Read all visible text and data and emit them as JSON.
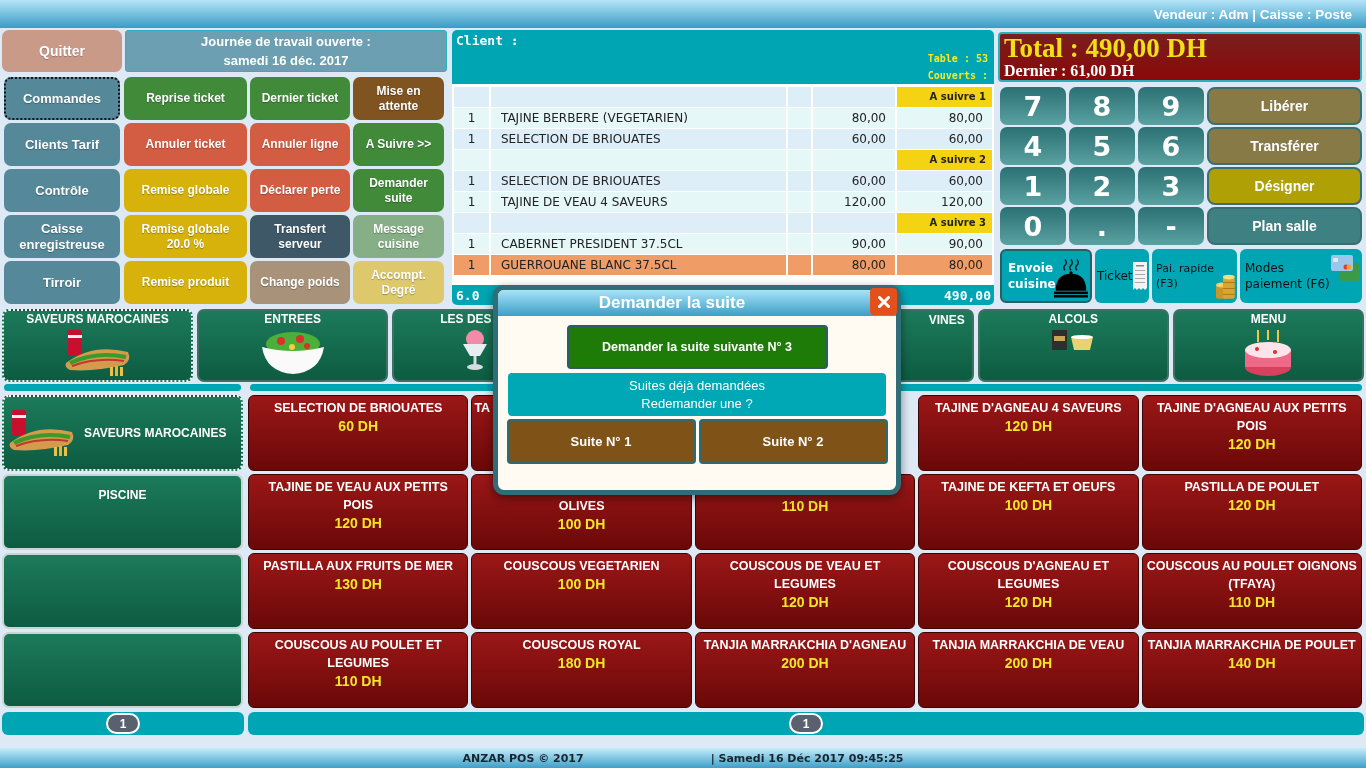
{
  "top_bar": {
    "session": "Vendeur : Adm | Caisse : Poste"
  },
  "quit_button": "Quitter",
  "workday": [
    "Journée de travail ouverte :",
    "samedi 16 déc. 2017"
  ],
  "nav_menu": [
    {
      "label": "Commandes",
      "selected": true
    },
    {
      "label": "Clients Tarif",
      "selected": false
    },
    {
      "label": "Contrôle",
      "selected": false
    },
    {
      "label": "Caisse enregistreuse",
      "selected": false
    },
    {
      "label": "Tirroir",
      "selected": false
    }
  ],
  "actions": [
    {
      "label": "Reprise ticket",
      "color": "#418a3a"
    },
    {
      "label": "Dernier ticket",
      "color": "#418a3a"
    },
    {
      "label": "Mise en attente",
      "color": "#7f5420"
    },
    {
      "label": "Annuler ticket",
      "color": "#d35d43"
    },
    {
      "label": "Annuler ligne",
      "color": "#d35d43"
    },
    {
      "label": "A Suivre >>",
      "color": "#418a3a"
    },
    {
      "label": "Remise globale",
      "color": "#d7b20b"
    },
    {
      "label": "Déclarer perte",
      "color": "#d35d43"
    },
    {
      "label": "Demander suite",
      "color": "#418a3a"
    },
    {
      "label": "Remise globale 20.0 %",
      "color": "#d7b20b"
    },
    {
      "label": "Transfert serveur",
      "color": "#3e5868"
    },
    {
      "label": "Message cuisine",
      "color": "#87af87"
    },
    {
      "label": "Remise produit",
      "color": "#d7b20b"
    },
    {
      "label": "Change poids",
      "color": "#a8937a"
    },
    {
      "label": "Accompt. Degré",
      "color": "#ddc96c"
    }
  ],
  "ticket": {
    "client": "Client :",
    "table": "Table : 53",
    "covers": "Couverts :",
    "courses": [
      {
        "label": "A suivre 1",
        "lines": [
          {
            "qty": "1",
            "name": "TAJINE BERBERE (VEGETARIEN)",
            "price": "80,00",
            "total": "80,00",
            "selected": false
          },
          {
            "qty": "1",
            "name": "SELECTION DE BRIOUATES",
            "price": "60,00",
            "total": "60,00",
            "selected": false
          }
        ]
      },
      {
        "label": "A suivre 2",
        "lines": [
          {
            "qty": "1",
            "name": "SELECTION DE BRIOUATES",
            "price": "60,00",
            "total": "60,00",
            "selected": false
          },
          {
            "qty": "1",
            "name": "TAJINE DE VEAU 4 SAVEURS",
            "price": "120,00",
            "total": "120,00",
            "selected": false
          }
        ]
      },
      {
        "label": "A suivre 3",
        "lines": [
          {
            "qty": "1",
            "name": "CABERNET PRESIDENT 37.5CL",
            "price": "90,00",
            "total": "90,00",
            "selected": false
          },
          {
            "qty": "1",
            "name": "GUERROUANE BLANC 37.5CL",
            "price": "80,00",
            "total": "80,00",
            "selected": true
          }
        ]
      }
    ],
    "line_count": "6.0",
    "total": "490,00"
  },
  "summary": {
    "total": "Total : 490,00 DH",
    "last": "Dernier : 61,00 DH"
  },
  "keypad": {
    "keys": [
      "7",
      "8",
      "9",
      "4",
      "5",
      "6",
      "1",
      "2",
      "3",
      "0",
      ".",
      "-"
    ],
    "actions": [
      {
        "label": "Libérer",
        "color": "#877a46"
      },
      {
        "label": "Transférer",
        "color": "#877a46"
      },
      {
        "label": "Désigner",
        "color": "#afa006"
      },
      {
        "label": "Plan salle",
        "color": "#3f8183"
      }
    ]
  },
  "shortcuts": [
    {
      "label": "Envoie cuisine",
      "kind": "kitchen"
    },
    {
      "label": "Ticket",
      "kind": "receipt"
    },
    {
      "label": "Pai. rapide (F3)",
      "kind": "cash"
    },
    {
      "label": "Modes paiement (F6)",
      "kind": "card"
    }
  ],
  "categories": [
    {
      "label": "SAVEURS MAROCAINES",
      "selected": true,
      "kind": "full"
    },
    {
      "label": "ENTREES",
      "selected": false,
      "kind": "full"
    },
    {
      "label": "LES DES",
      "selected": false,
      "kind": "cut-right"
    },
    {
      "kind": "covered"
    },
    {
      "label": "VINES",
      "selected": false,
      "kind": "cut-left"
    },
    {
      "label": "ALCOLS",
      "selected": false,
      "kind": "full"
    },
    {
      "label": "MENU",
      "selected": false,
      "kind": "full"
    }
  ],
  "subcategories": [
    {
      "label": "SAVEURS MAROCAINES",
      "selected": true,
      "kind": "picture"
    },
    {
      "label": "PISCINE",
      "selected": false,
      "kind": "text"
    },
    {
      "selected": false,
      "kind": "blank"
    },
    {
      "selected": false,
      "kind": "blank"
    }
  ],
  "products": [
    {
      "name": "SELECTION DE BRIOUATES",
      "price": "60 DH",
      "kind": "full"
    },
    {
      "name": "TA",
      "kind": "cut-right"
    },
    {
      "kind": "covered"
    },
    {
      "name": "TAJINE D'AGNEAU 4 SAVEURS",
      "price": "120 DH",
      "kind": "full"
    },
    {
      "name": "TAJINE D'AGNEAU AUX PETITS POIS",
      "price": "120 DH",
      "kind": "full"
    },
    {
      "name": "TAJINE DE VEAU AUX PETITS POIS",
      "price": "120 DH",
      "kind": "full"
    },
    {
      "name": "OLIVES",
      "price": "100 DH",
      "kind": "cut-top"
    },
    {
      "price": "110 DH",
      "kind": "cut-top"
    },
    {
      "name": "TAJINE DE KEFTA ET OEUFS",
      "price": "100 DH",
      "kind": "full"
    },
    {
      "name": "PASTILLA DE POULET",
      "price": "120 DH",
      "kind": "full"
    },
    {
      "name": "PASTILLA AUX FRUITS DE MER",
      "price": "130 DH",
      "kind": "full"
    },
    {
      "name": "COUSCOUS VEGETARIEN",
      "price": "100 DH",
      "kind": "full"
    },
    {
      "name": "COUSCOUS DE VEAU ET LEGUMES",
      "price": "120 DH",
      "kind": "full"
    },
    {
      "name": "COUSCOUS D'AGNEAU ET LEGUMES",
      "price": "120 DH",
      "kind": "full"
    },
    {
      "name": "COUSCOUS AU POULET OIGNONS (TFAYA)",
      "price": "110 DH",
      "kind": "full"
    },
    {
      "name": "COUSCOUS AU POULET ET LEGUMES",
      "price": "110 DH",
      "kind": "full"
    },
    {
      "name": "COUSCOUS ROYAL",
      "price": "180 DH",
      "kind": "full"
    },
    {
      "name": "TANJIA MARRAKCHIA D'AGNEAU",
      "price": "200 DH",
      "kind": "full"
    },
    {
      "name": "TANJIA MARRAKCHIA DE VEAU",
      "price": "200 DH",
      "kind": "full"
    },
    {
      "name": "TANJIA MARRAKCHIA DE POULET",
      "price": "140 DH",
      "kind": "full"
    }
  ],
  "pagers": {
    "categories": "1",
    "products": "1"
  },
  "status_bar": {
    "copyright": "ANZAR POS © 2017",
    "datetime": "| Samedi 16 Déc 2017 09:45:25"
  },
  "dialog": {
    "title": "Demander la suite",
    "next_button": "Demander la suite suivante N° 3",
    "repeat_prompt": [
      "Suites déjà demandées",
      "Redemander une ?"
    ],
    "previous": [
      "Suite N° 1",
      "Suite N° 2"
    ]
  }
}
